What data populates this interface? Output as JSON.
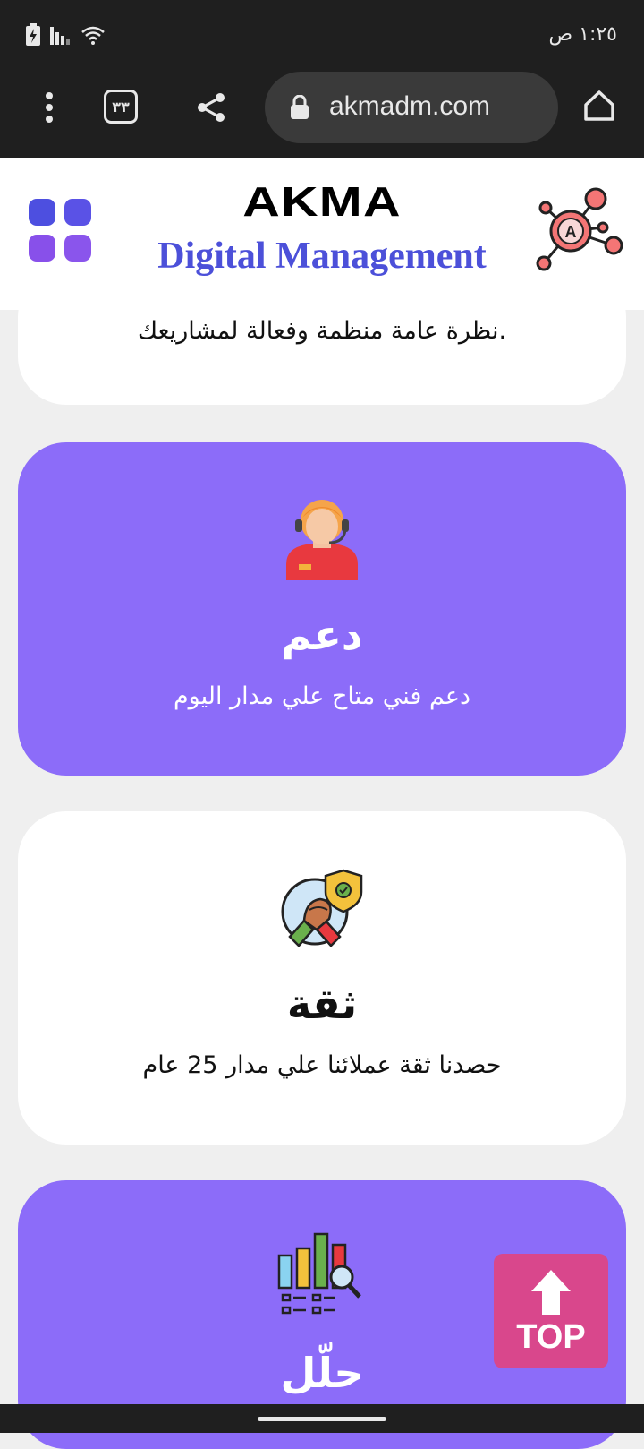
{
  "status": {
    "time": "١:٢٥ ص"
  },
  "browser": {
    "url": "akmadm.com",
    "tab_count": "٣٣"
  },
  "header": {
    "brand": "AKMA",
    "subtitle": "Digital Management"
  },
  "cards": [
    {
      "desc": "نظرة عامة منظمة وفعالة لمشاريعك."
    },
    {
      "title": "دعم",
      "desc": "دعم فني متاح علي مدار اليوم",
      "icon": "support-agent-icon"
    },
    {
      "title": "ثقة",
      "desc": "حصدنا ثقة عملائنا علي مدار 25 عام",
      "icon": "handshake-shield-icon"
    },
    {
      "title": "حلّل",
      "icon": "analytics-chart-icon"
    }
  ],
  "top_button": {
    "label": "TOP"
  },
  "colors": {
    "purple": "#8c6cf9",
    "brand_blue": "#4c50d9",
    "top_pink": "#d9478c"
  }
}
